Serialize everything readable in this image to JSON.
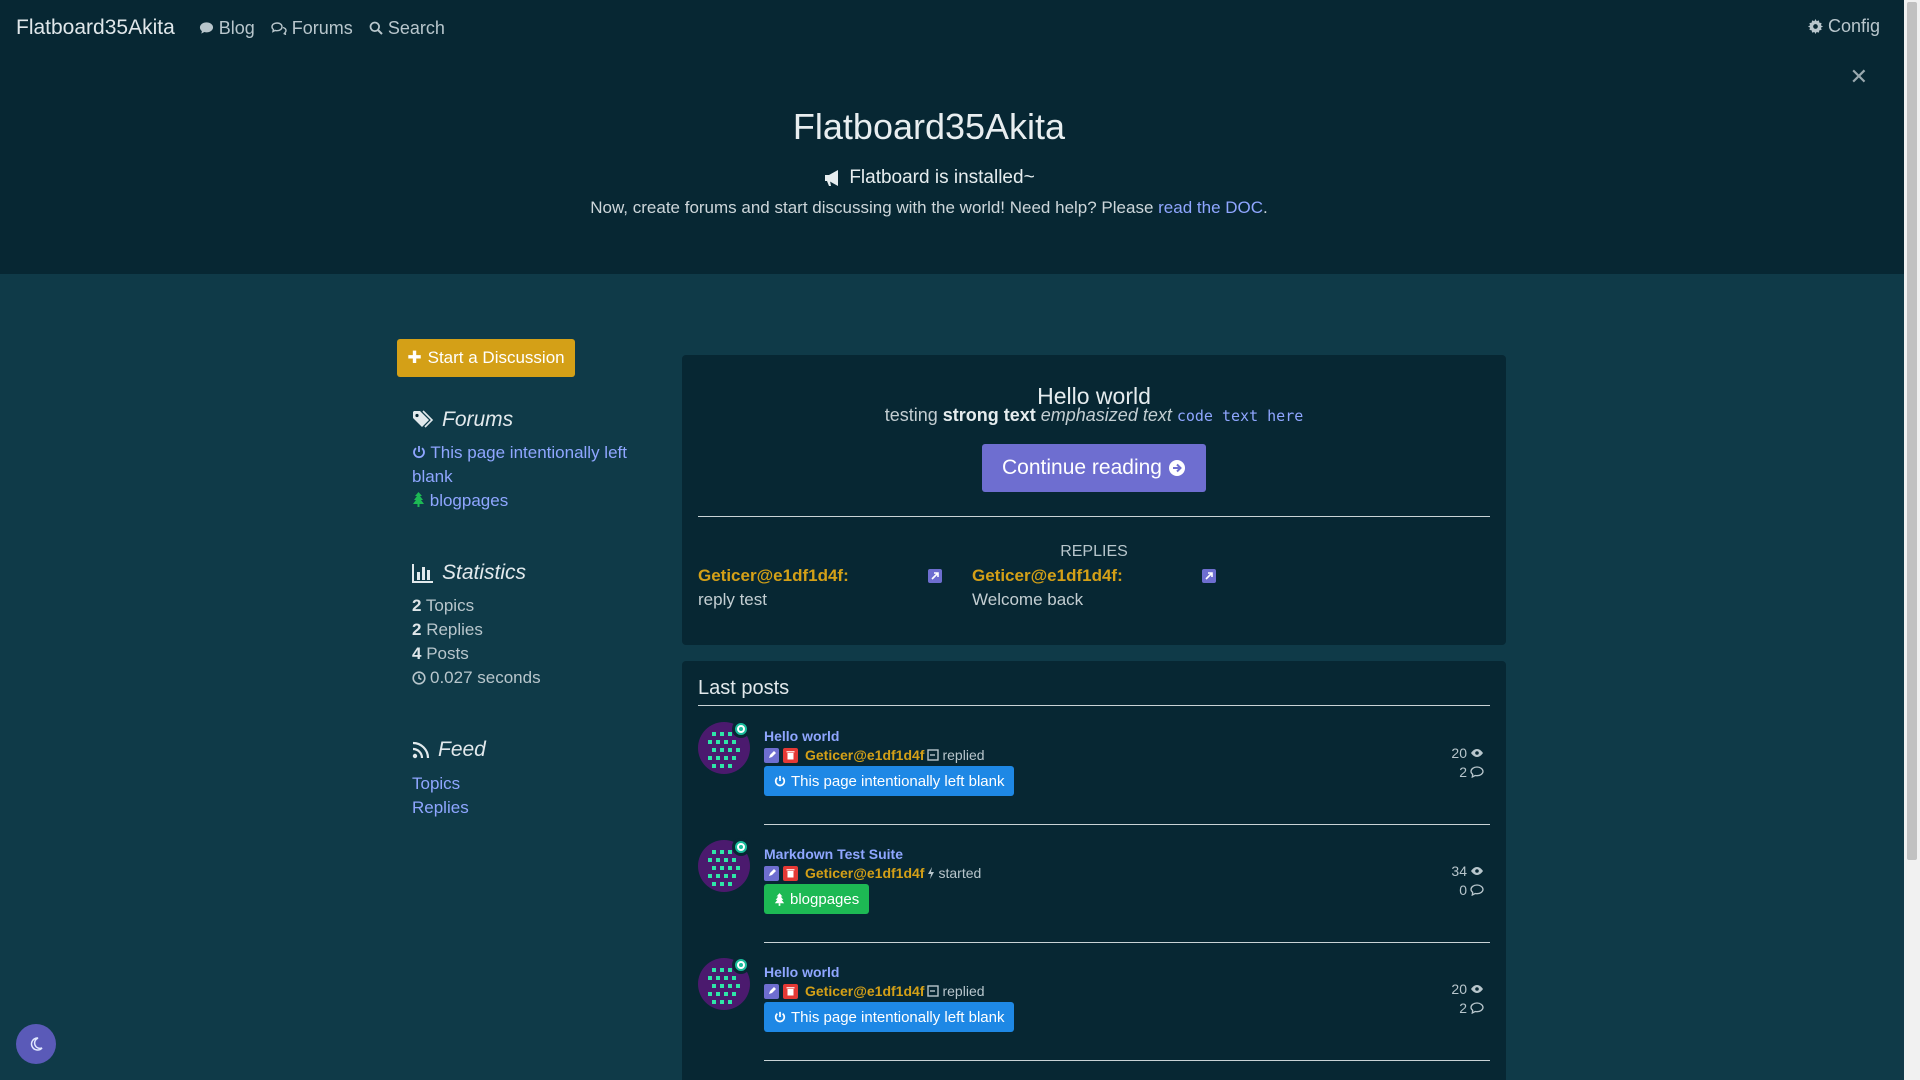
{
  "nav": {
    "brand": "Flatboard35Akita",
    "blog": "Blog",
    "forums": "Forums",
    "search": "Search",
    "config": "Config"
  },
  "hero": {
    "title": "Flatboard35Akita",
    "subtitle": "Flatboard is installed~",
    "text": "Now, create forums and start discussing with the world! Need help? Please ",
    "link": "read the DOC",
    "text_end": "."
  },
  "sidebar": {
    "start_button": "Start a Discussion",
    "forums_heading": "Forums",
    "forums": [
      {
        "label": "This page intentionally left blank"
      },
      {
        "label": "blogpages"
      }
    ],
    "statistics_heading": "Statistics",
    "stats": [
      {
        "value": "2",
        "label": " Topics"
      },
      {
        "value": "2",
        "label": " Replies"
      },
      {
        "value": "4",
        "label": " Posts"
      }
    ],
    "time": "0.027 seconds",
    "feed_heading": "Feed",
    "feed": [
      {
        "label": "Topics"
      },
      {
        "label": "Replies"
      }
    ]
  },
  "post": {
    "title": "Hello world",
    "body_plain": "testing ",
    "body_strong": "strong text",
    "body_em": " emphasized text ",
    "body_code": "code text here",
    "continue": "Continue reading",
    "replies_heading": "REPLIES",
    "replies": [
      {
        "author": "Geticer@e1df1d4f:",
        "text": "reply test"
      },
      {
        "author": "Geticer@e1df1d4f:",
        "text": "Welcome back"
      }
    ]
  },
  "last_posts": {
    "heading": "Last posts",
    "items": [
      {
        "title": "Hello world",
        "author": "Geticer@e1df1d4f",
        "action": "replied",
        "tag": "This page intentionally left blank",
        "tag_color": "#1e88e5",
        "views": "20",
        "replies": "2"
      },
      {
        "title": "Markdown Test Suite",
        "author": "Geticer@e1df1d4f",
        "action": "started",
        "tag": "blogpages",
        "tag_color": "#1db954",
        "views": "34",
        "replies": "0"
      },
      {
        "title": "Hello world",
        "author": "Geticer@e1df1d4f",
        "action": "replied",
        "tag": "This page intentionally left blank",
        "tag_color": "#1e88e5",
        "views": "20",
        "replies": "2"
      }
    ]
  },
  "colors": {
    "accent": "#d4a017",
    "link": "#8fa6ff",
    "button": "#6e6ed0",
    "header_bg": "#072733",
    "page_bg": "#0f3a48"
  }
}
